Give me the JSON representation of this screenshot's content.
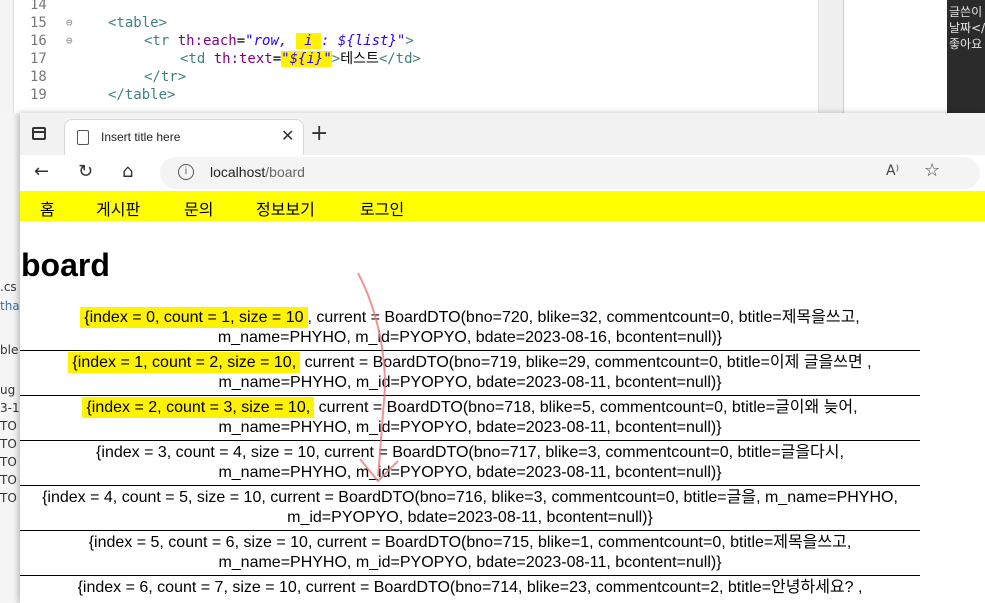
{
  "editor": {
    "lines": [
      {
        "num": "14",
        "fold": "",
        "parts": []
      },
      {
        "num": "15",
        "fold": "⊖",
        "parts": [
          {
            "t": "<table>",
            "c": "tag"
          }
        ]
      },
      {
        "num": "16",
        "fold": "⊖",
        "parts": [
          {
            "t": "<tr ",
            "c": "tag"
          },
          {
            "t": "th:each",
            "c": "attr"
          },
          {
            "t": "=",
            "c": "txt"
          },
          {
            "t": "\"row, ",
            "c": "str"
          },
          {
            "t": " i ",
            "c": "str hl"
          },
          {
            "t": ": ${list}\"",
            "c": "str"
          },
          {
            "t": ">",
            "c": "tag"
          }
        ]
      },
      {
        "num": "17",
        "fold": "",
        "parts": [
          {
            "t": "<td ",
            "c": "tag"
          },
          {
            "t": "th:text",
            "c": "attr"
          },
          {
            "t": "=",
            "c": "txt"
          },
          {
            "t": "\"${i}\"",
            "c": "str hl"
          },
          {
            "t": ">",
            "c": "tag"
          },
          {
            "t": "테스트",
            "c": "txt"
          },
          {
            "t": "</td>",
            "c": "tag"
          }
        ]
      },
      {
        "num": "18",
        "fold": "",
        "parts": [
          {
            "t": "</tr>",
            "c": "tag"
          }
        ]
      },
      {
        "num": "19",
        "fold": "",
        "parts": [
          {
            "t": "</table>",
            "c": "tag"
          }
        ]
      }
    ]
  },
  "console": {
    "lines": [
      "글쓴이",
      "날짜</",
      "좋아요"
    ]
  },
  "leftpane": {
    "fragments": [
      ".cs",
      "tha",
      "ble",
      "ug",
      "3-1",
      "TO",
      "TO",
      "TO",
      "TO",
      "TO"
    ]
  },
  "browser": {
    "tab_title": "Insert title here",
    "tab_close": "✕",
    "new_tab": "+",
    "url_host": "localhost",
    "url_path": "/board",
    "info_icon": "i",
    "read_aloud": "A⁾",
    "favorite": "☆",
    "back": "←",
    "reload": "↻",
    "home": "⌂"
  },
  "page": {
    "menu": [
      "홈",
      "게시판",
      "문의",
      "정보보기",
      "로그인"
    ],
    "heading": "board",
    "rows": [
      {
        "mark": "{index = 0, count = 1, size = 10",
        "rest": ", current = BoardDTO(bno=720, blike=32, commentcount=0, btitle=제목을쓰고,",
        "l2": "m_name=PHYHO, m_id=PYOPYO, bdate=2023-08-16, bcontent=null)}"
      },
      {
        "mark": "{index = 1, count = 2, size = 10,",
        "rest": " current = BoardDTO(bno=719, blike=29, commentcount=0, btitle=이제 글을쓰면 ,",
        "l2": "m_name=PHYHO, m_id=PYOPYO, bdate=2023-08-11, bcontent=null)}"
      },
      {
        "mark": "{index = 2, count = 3, size = 10,",
        "rest": " current = BoardDTO(bno=718, blike=5, commentcount=0, btitle=글이왜 늦어,",
        "l2": "m_name=PHYHO, m_id=PYOPYO, bdate=2023-08-11, bcontent=null)}"
      },
      {
        "mark": "",
        "rest": "{index = 3, count = 4, size = 10, current = BoardDTO(bno=717, blike=3, commentcount=0, btitle=글을다시,",
        "l2": "m_name=PHYHO, m_id=PYOPYO, bdate=2023-08-11, bcontent=null)}"
      },
      {
        "mark": "",
        "rest": "{index = 4, count = 5, size = 10, current = BoardDTO(bno=716, blike=3, commentcount=0, btitle=글을, m_name=PHYHO,",
        "l2": "m_id=PYOPYO, bdate=2023-08-11, bcontent=null)}"
      },
      {
        "mark": "",
        "rest": "{index = 5, count = 6, size = 10, current = BoardDTO(bno=715, blike=1, commentcount=0, btitle=제목을쓰고,",
        "l2": "m_name=PHYHO, m_id=PYOPYO, bdate=2023-08-11, bcontent=null)}"
      },
      {
        "mark": "",
        "rest": "{index = 6, count = 7, size = 10, current = BoardDTO(bno=714, blike=23, commentcount=2, btitle=안녕하세요? ,",
        "l2": ""
      }
    ]
  },
  "colors": {
    "menu_bg": "#ffff00",
    "highlight": "#fff200",
    "annotation_arrow": "#e87a7a"
  }
}
